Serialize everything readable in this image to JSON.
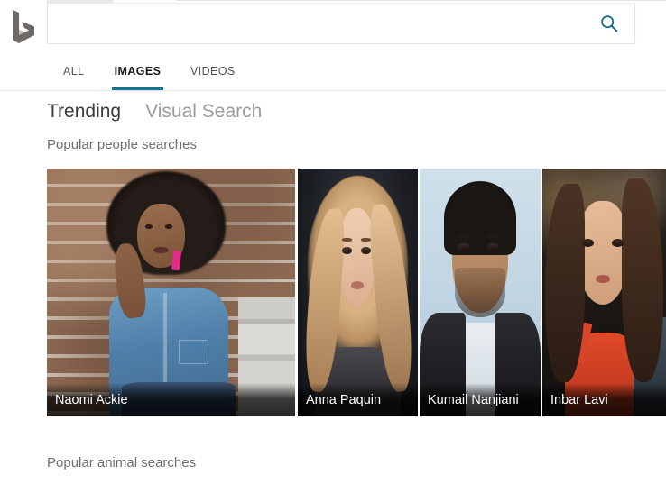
{
  "brand": {
    "logo_name": "bing-logo",
    "logo_color": "#6e6a68"
  },
  "search": {
    "value": "",
    "placeholder": "",
    "button_icon": "search-icon",
    "icon_color": "#0f6a8f"
  },
  "tabs": [
    {
      "label": "ALL",
      "active": false
    },
    {
      "label": "IMAGES",
      "active": true
    },
    {
      "label": "VIDEOS",
      "active": false
    }
  ],
  "accent_color": "#0f7899",
  "modes": [
    {
      "label": "Trending",
      "active": true
    },
    {
      "label": "Visual Search",
      "active": false
    }
  ],
  "sections": {
    "people_title": "Popular people searches",
    "animal_title": "Popular animal searches"
  },
  "people_tiles": [
    {
      "name": "Naomi Ackie"
    },
    {
      "name": "Anna Paquin"
    },
    {
      "name": "Kumail Nanjiani"
    },
    {
      "name": "Inbar Lavi"
    }
  ]
}
